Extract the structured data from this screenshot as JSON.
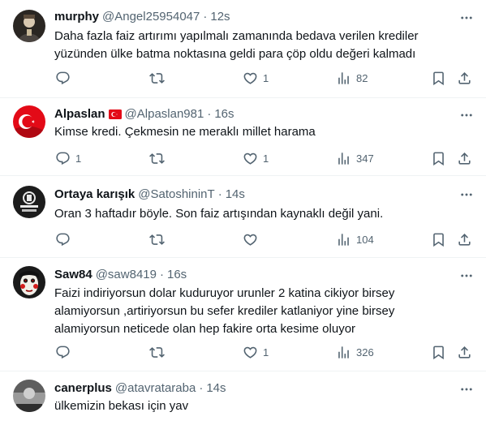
{
  "tweets": [
    {
      "name": "murphy",
      "handle": "@Angel25954047",
      "time": "12s",
      "text": "Daha fazla faiz artırımı yapılmalı zamanında bedava verilen krediler\nyüzünden ülke batma noktasına geldi para çöp oldu değeri kalmadı",
      "replies": "",
      "retweets": "",
      "likes": "1",
      "views": "82",
      "avatar_icon": "dark-portrait-avatar"
    },
    {
      "name": "Alpaslan",
      "handle": "@Alpaslan981",
      "time": "16s",
      "text": "Kimse kredi. Çekmesin ne meraklı millet harama",
      "replies": "1",
      "retweets": "",
      "likes": "1",
      "views": "347",
      "avatar_icon": "turkish-flag-avatar",
      "name_badge": "turkish-flag-emoji"
    },
    {
      "name": "Ortaya karışık",
      "handle": "@SatoshininT",
      "time": "14s",
      "text": "Oran 3 haftadır böyle. Son faiz artışından kaynaklı değil yani.",
      "replies": "",
      "retweets": "",
      "likes": "",
      "views": "104",
      "avatar_icon": "dark-logo-avatar"
    },
    {
      "name": "Saw84",
      "handle": "@saw8419",
      "time": "16s",
      "text": "Faizi indiriyorsun dolar kuduruyor urunler 2 katina cikiyor birsey\nalamiyorsun ,artiriyorsun bu sefer krediler katlaniyor yine birsey\nalamiyorsun neticede olan hep fakire orta kesime oluyor",
      "replies": "",
      "retweets": "",
      "likes": "1",
      "views": "326",
      "avatar_icon": "puppet-mask-avatar"
    },
    {
      "name": "canerplus",
      "handle": "@atavrataraba",
      "time": "14s",
      "text": "ülkemizin bekası için yav",
      "avatar_icon": "grayscale-photo-avatar"
    }
  ],
  "colors": {
    "text": "#0f1419",
    "secondary": "#536471",
    "divider": "#eff3f4",
    "flag_red": "#e30a17"
  }
}
